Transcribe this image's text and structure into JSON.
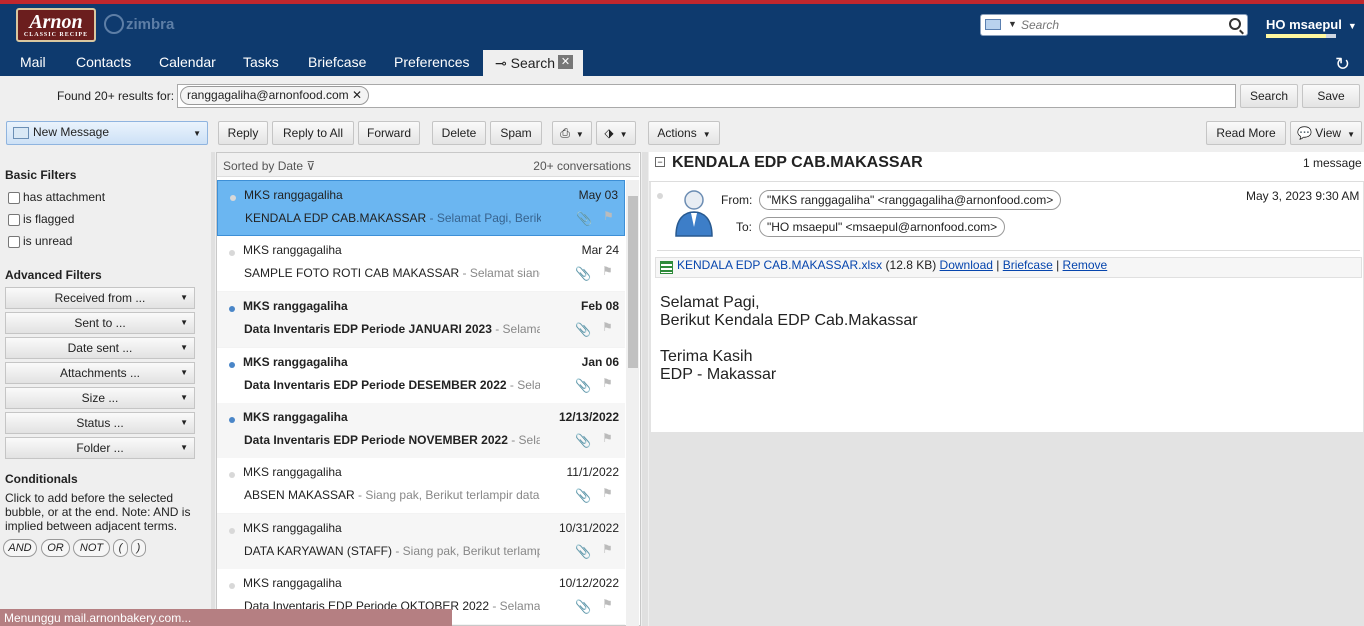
{
  "app": {
    "logo_text": "Arnon",
    "logo_sub": "CLASSIC RECIPE",
    "brand": "zimbra",
    "search_placeholder": "Search",
    "user": "HO msaepul"
  },
  "nav": {
    "tabs": [
      "Mail",
      "Contacts",
      "Calendar",
      "Tasks",
      "Briefcase",
      "Preferences"
    ],
    "active_tab": "Search"
  },
  "search": {
    "found_label": "Found 20+ results for:",
    "query_bubble": "ranggagaliha@arnonfood.com",
    "search_button": "Search",
    "save_button": "Save"
  },
  "toolbar": {
    "new_message": "New Message",
    "reply": "Reply",
    "reply_all": "Reply to All",
    "forward": "Forward",
    "delete": "Delete",
    "spam": "Spam",
    "actions": "Actions",
    "read_more": "Read More",
    "view": "View"
  },
  "filters": {
    "basic_title": "Basic Filters",
    "basic": [
      "has attachment",
      "is flagged",
      "is unread"
    ],
    "advanced_title": "Advanced Filters",
    "advanced": [
      "Received from ...",
      "Sent to ...",
      "Date sent ...",
      "Attachments ...",
      "Size ...",
      "Status ...",
      "Folder ..."
    ],
    "conditionals_title": "Conditionals",
    "conditionals_text": "Click to add before the selected bubble, or at the end. Note: AND is implied between adjacent terms.",
    "ops": [
      "AND",
      "OR",
      "NOT",
      "(",
      ")"
    ]
  },
  "list": {
    "sort_label": "Sorted by Date",
    "count_label": "20+ conversations",
    "rows": [
      {
        "from": "MKS ranggagaliha",
        "date": "May 03",
        "subject": "KENDALA EDP CAB.MAKASSAR",
        "fragment": " - Selamat Pagi, Berikut Kendala EDP Cab.Makassar"
      },
      {
        "from": "MKS ranggagaliha",
        "date": "Mar 24",
        "subject": "SAMPLE FOTO ROTI CAB MAKASSAR",
        "fragment": " - Selamat siang, Berikut"
      },
      {
        "from": "MKS ranggagaliha",
        "date": "Feb 08",
        "subject": "Data Inventaris EDP Periode JANUARI 2023",
        "fragment": " - Selamat Pagi"
      },
      {
        "from": "MKS ranggagaliha",
        "date": "Jan 06",
        "subject": "Data Inventaris EDP Periode DESEMBER 2022",
        "fragment": " - Selamat Pagi"
      },
      {
        "from": "MKS ranggagaliha",
        "date": "12/13/2022",
        "subject": "Data Inventaris EDP Periode NOVEMBER 2022",
        "fragment": " - Selamat Pagi"
      },
      {
        "from": "MKS ranggagaliha",
        "date": "11/1/2022",
        "subject": "ABSEN MAKASSAR",
        "fragment": " - Siang pak, Berikut terlampir data karyawan"
      },
      {
        "from": "MKS ranggagaliha",
        "date": "10/31/2022",
        "subject": "DATA KARYAWAN (STAFF)",
        "fragment": " - Siang pak, Berikut terlampir data"
      },
      {
        "from": "MKS ranggagaliha",
        "date": "10/12/2022",
        "subject": "Data Inventaris EDP Periode OKTOBER 2022",
        "fragment": " - Selamat Pagi"
      }
    ]
  },
  "reading": {
    "title": "KENDALA EDP CAB.MAKASSAR",
    "count": "1 message",
    "from_label": "From:",
    "to_label": "To:",
    "from": "\"MKS ranggagaliha\" <ranggagaliha@arnonfood.com>",
    "to": "\"HO msaepul\" <msaepul@arnonfood.com>",
    "date": "May 3, 2023 9:30 AM",
    "attachment_name": "KENDALA EDP CAB.MAKASSAR.xlsx",
    "attachment_size": " (12.8 KB) ",
    "download": "Download",
    "briefcase": "Briefcase",
    "remove": "Remove",
    "sep": " | ",
    "body": [
      "Selamat Pagi,",
      "Berikut Kendala EDP Cab.Makassar",
      "",
      "Terima Kasih",
      "EDP - Makassar"
    ]
  },
  "status": "Menunggu mail.arnonbakery.com..."
}
